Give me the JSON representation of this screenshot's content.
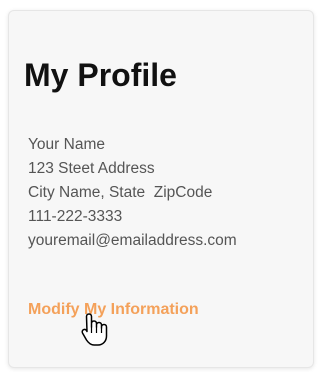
{
  "profile": {
    "title": "My Profile",
    "name": "Your Name",
    "address": "123 Steet Address",
    "city_state_zip": "City Name, State  ZipCode",
    "phone": "111-222-3333",
    "email": "youremail@emailaddress.com",
    "modify_link_label": "Modify My Information"
  },
  "colors": {
    "link": "#f4a15a",
    "text": "#555555",
    "title": "#111111"
  },
  "icons": {
    "cursor": "hand-pointer-icon"
  }
}
